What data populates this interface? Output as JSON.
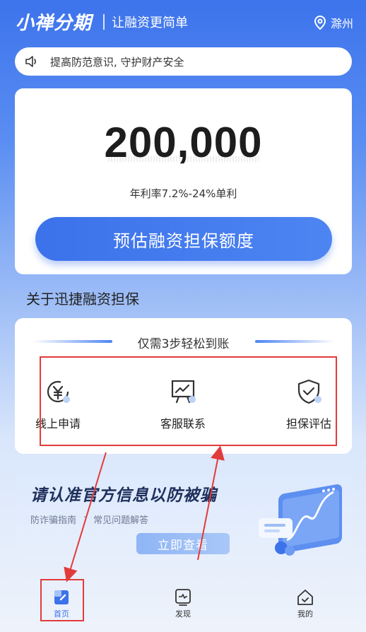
{
  "header": {
    "logo": "小禅分期",
    "slogan": "让融资更简单",
    "location": "滁州"
  },
  "notice": {
    "text": "提高防范意识, 守护财产安全",
    "icon": "speaker-icon"
  },
  "quota_card": {
    "amount": "200,000",
    "rate": "年利率7.2%-24%单利",
    "cta": "预估融资担保额度"
  },
  "about": {
    "title": "关于迅捷融资担保"
  },
  "steps": {
    "heading": "仅需3步轻松到账",
    "items": [
      {
        "label": "线上申请",
        "icon": "yuan-refresh-icon"
      },
      {
        "label": "客服联系",
        "icon": "presentation-chart-icon"
      },
      {
        "label": "担保评估",
        "icon": "shield-check-icon"
      }
    ]
  },
  "banner": {
    "title": "请认准官方信息以防被骗",
    "sub_left": "防诈骗指南",
    "sub_dot": "·",
    "sub_right": "常见问题解答",
    "button": "立即查看"
  },
  "tabbar": {
    "items": [
      {
        "label": "首页",
        "icon": "home-icon",
        "active": true
      },
      {
        "label": "发现",
        "icon": "discover-icon",
        "active": false
      },
      {
        "label": "我的",
        "icon": "profile-house-icon",
        "active": false
      }
    ]
  },
  "colors": {
    "primary": "#3c72ea",
    "annotation": "#e23b3b"
  }
}
